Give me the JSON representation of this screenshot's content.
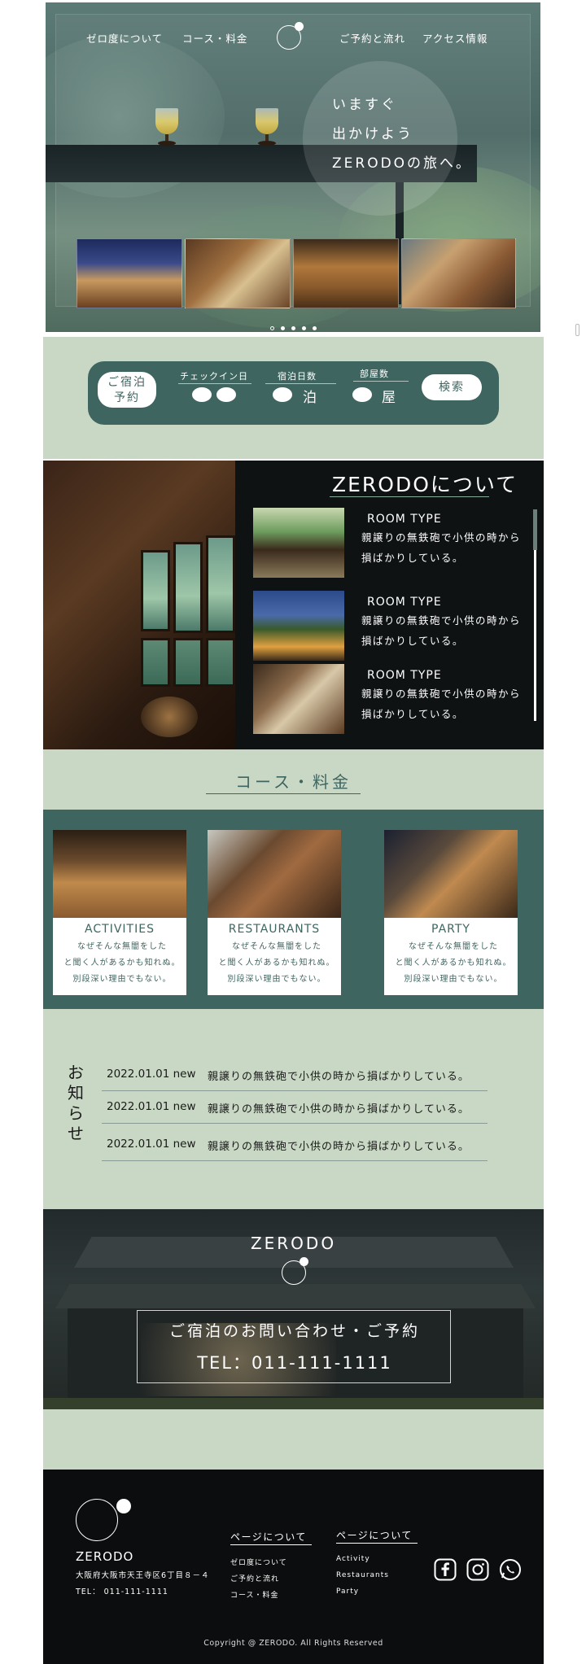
{
  "nav": {
    "about": "ゼロ度について",
    "course": "コース・料金",
    "reserve": "ご予約と流れ",
    "access": "アクセス情報"
  },
  "hero": {
    "copy_line1": "いますぐ",
    "copy_line2": "出かけよう",
    "copy_line3": "ZERODOの旅へ。"
  },
  "booking": {
    "reserve_line1": "ご宿泊",
    "reserve_line2": "予約",
    "checkin_label": "チェックイン日",
    "nights_label": "宿泊日数",
    "nights_unit": "泊",
    "rooms_label": "部屋数",
    "rooms_unit": "屋",
    "search_label": "検索"
  },
  "about": {
    "title": "ZERODOについて",
    "rooms": [
      {
        "type": "ROOM TYPE",
        "desc": "親譲りの無鉄砲で小供の時から損ばかりしている。"
      },
      {
        "type": "ROOM TYPE",
        "desc": "親譲りの無鉄砲で小供の時から損ばかりしている。"
      },
      {
        "type": "ROOM TYPE",
        "desc": "親譲りの無鉄砲で小供の時から損ばかりしている。"
      }
    ]
  },
  "course": {
    "title": "コース・料金",
    "cards": [
      {
        "title": "ACTIVITIES",
        "l1": "なぜそんな無闇をした",
        "l2": "と聞く人があるかも知れぬ。",
        "l3": "別段深い理由でもない。"
      },
      {
        "title": "RESTAURANTS",
        "l1": "なぜそんな無闇をした",
        "l2": "と聞く人があるかも知れぬ。",
        "l3": "別段深い理由でもない。"
      },
      {
        "title": "PARTY",
        "l1": "なぜそんな無闇をした",
        "l2": "と聞く人があるかも知れぬ。",
        "l3": "別段深い理由でもない。"
      }
    ]
  },
  "news": {
    "title": "お知らせ",
    "items": [
      {
        "date": "2022.01.01 new",
        "text": "親譲りの無鉄砲で小供の時から損ばかりしている。"
      },
      {
        "date": "2022.01.01 new",
        "text": "親譲りの無鉄砲で小供の時から損ばかりしている。"
      },
      {
        "date": "2022.01.01 new",
        "text": "親譲りの無鉄砲で小供の時から損ばかりしている。"
      }
    ]
  },
  "contact": {
    "brand": "ZERODO",
    "line1": "ご宿泊のお問い合わせ・ご予約",
    "line2": "TEL：011-111-1111"
  },
  "footer": {
    "brand": "ZERODO",
    "address": "大阪府大阪市天王寺区6丁目８－４",
    "tel": "TEL： 011-111-1111",
    "col1_title": "ページについて",
    "col1_links": [
      "ゼロ度について",
      "ご予約と流れ",
      "コース・料金"
    ],
    "col2_title": "ページについて",
    "col2_links": [
      "Activity",
      "Restaurants",
      "Party"
    ],
    "copyright": "Copyright @ ZERODO. All Rights Reserved"
  },
  "colors": {
    "sage": "#c8d8c4",
    "teal": "#3f6560",
    "dark": "#0b0d0e"
  },
  "icons": [
    "facebook-icon",
    "instagram-icon",
    "whatsapp-icon"
  ]
}
